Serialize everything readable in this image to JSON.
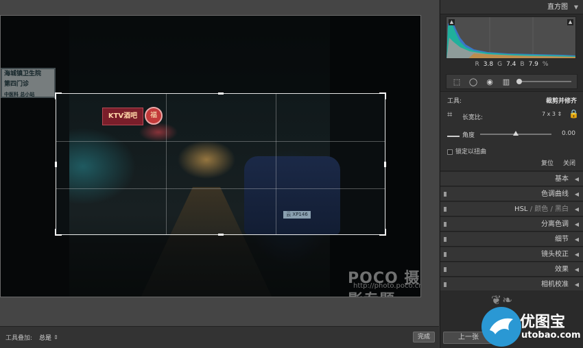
{
  "canvas": {
    "photo_texts": {
      "store_sign_line1": "海城镇卫生院",
      "store_sign_line2": "第四门诊",
      "store_sign_line3": "中医科 总小站",
      "red_sign": "KTV酒吧",
      "lamp_text": "福",
      "plate": "云 XP146"
    },
    "watermark": "POCO 摄影专题",
    "watermark_url": "http://photo.poco.cn/"
  },
  "toolbar": {
    "overlay_label": "工具叠加:",
    "overlay_value": "总是",
    "updown_icon": "up-down-arrows-icon",
    "done_label": "完成"
  },
  "histogram": {
    "title": "直方图",
    "r_label": "R",
    "r_value": "3.8",
    "g_label": "G",
    "g_value": "7.4",
    "b_label": "B",
    "b_value": "7.9",
    "unit": "%"
  },
  "crop_panel": {
    "tool_label": "工具:",
    "tool_name": "裁剪并修齐",
    "aspect_label": "长宽比:",
    "aspect_value": "7 x 3",
    "angle_label": "角度",
    "angle_value": "0.00",
    "angle_fraction": 0.5,
    "constrain_label": "锁定以扭曲",
    "reset_label": "复位",
    "close_label": "关闭"
  },
  "sections": [
    {
      "label": "基本"
    },
    {
      "label": "色调曲线"
    },
    {
      "label": "HSL / 颜色 / 黑白"
    },
    {
      "label": "分离色调"
    },
    {
      "label": "细节"
    },
    {
      "label": "镜头校正"
    },
    {
      "label": "效果"
    },
    {
      "label": "相机校准"
    }
  ],
  "hsl_parts": {
    "hsl": "HSL",
    "sep1": "/",
    "color": "颜色",
    "sep2": "/",
    "bw": "黑白"
  },
  "bottom": {
    "prev_label": "上一张",
    "logo_text": "优图宝",
    "logo_url": "utobao.com"
  },
  "colors": {
    "panel_bg": "#2a2a2a",
    "canvas_bg": "#454545",
    "histogram_teal": "#1fb39a",
    "histogram_blue": "#3a7bd5",
    "logo_blue": "#2a98d4"
  }
}
